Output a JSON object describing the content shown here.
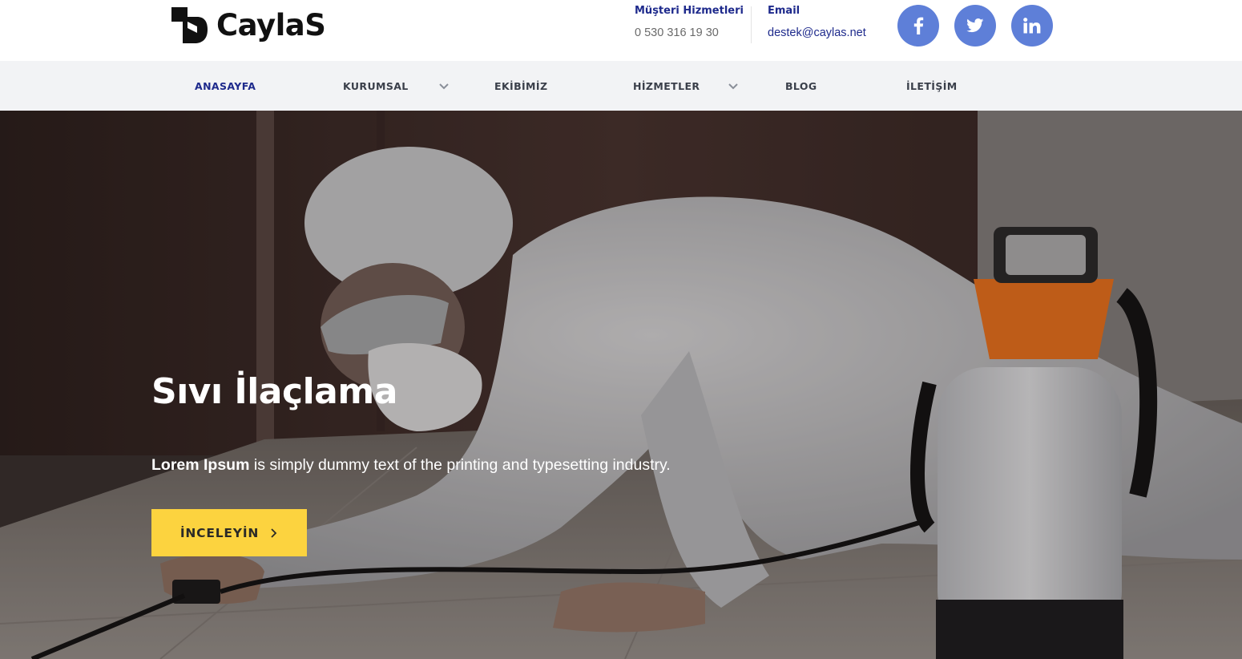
{
  "brand": {
    "name": "CaylaS",
    "logo_icon": "caylas-logo-mark"
  },
  "contact": {
    "service_label": "Müşteri Hizmetleri",
    "phone": "0 530 316 19 30",
    "email_label": "Email",
    "email": "destek@caylas.net"
  },
  "social": [
    {
      "name": "facebook",
      "icon": "facebook-icon",
      "glyph": "f"
    },
    {
      "name": "twitter",
      "icon": "twitter-icon"
    },
    {
      "name": "linkedin",
      "icon": "linkedin-icon",
      "glyph": "in"
    }
  ],
  "nav": {
    "items": [
      {
        "label": "ANASAYFA",
        "active": true,
        "has_dropdown": false
      },
      {
        "label": "KURUMSAL",
        "active": false,
        "has_dropdown": true
      },
      {
        "label": "EKİBİMİZ",
        "active": false,
        "has_dropdown": false
      },
      {
        "label": "HİZMETLER",
        "active": false,
        "has_dropdown": true
      },
      {
        "label": "BLOG",
        "active": false,
        "has_dropdown": false
      },
      {
        "label": "İLETİŞİM",
        "active": false,
        "has_dropdown": false
      }
    ]
  },
  "hero": {
    "title": "Sıvı İlaçlama",
    "text_bold": "Lorem Ipsum",
    "text_rest": " is simply dummy text of the printing and typesetting industry.",
    "button_label": "İNCELEYİN",
    "button_icon": "chevron-right-icon"
  },
  "colors": {
    "brand_blue": "#1e2a8c",
    "social_blue": "#5e7fd8",
    "cta_yellow": "#fcd33f",
    "nav_bg": "#f2f3f5"
  }
}
